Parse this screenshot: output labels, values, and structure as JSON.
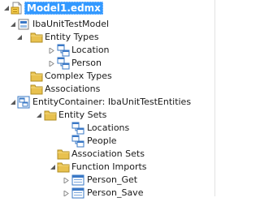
{
  "tree": {
    "root": {
      "label": "Model1.edmx",
      "icon": "edmx-file-icon",
      "selected": true
    },
    "model": {
      "label": "IbaUnitTestModel",
      "icon": "model-icon"
    },
    "entity_types": {
      "label": "Entity Types",
      "icon": "folder-icon"
    },
    "entity_location": {
      "label": "Location",
      "icon": "entity-type-icon"
    },
    "entity_person": {
      "label": "Person",
      "icon": "entity-type-icon"
    },
    "complex_types": {
      "label": "Complex Types",
      "icon": "folder-icon"
    },
    "associations": {
      "label": "Associations",
      "icon": "folder-icon"
    },
    "container": {
      "label": "EntityContainer: IbaUnitTestEntities",
      "icon": "entity-container-icon"
    },
    "entity_sets": {
      "label": "Entity Sets",
      "icon": "folder-icon"
    },
    "set_locations": {
      "label": "Locations",
      "icon": "entity-set-icon"
    },
    "set_people": {
      "label": "People",
      "icon": "entity-set-icon"
    },
    "association_sets": {
      "label": "Association Sets",
      "icon": "folder-icon"
    },
    "function_imports": {
      "label": "Function Imports",
      "icon": "folder-icon"
    },
    "fn_person_get": {
      "label": "Person_Get",
      "icon": "function-import-icon"
    },
    "fn_person_save": {
      "label": "Person_Save",
      "icon": "function-import-icon"
    }
  },
  "colors": {
    "selection": "#3399ff",
    "folder": "#e8c14f",
    "entity_blue": "#3a78c6"
  }
}
